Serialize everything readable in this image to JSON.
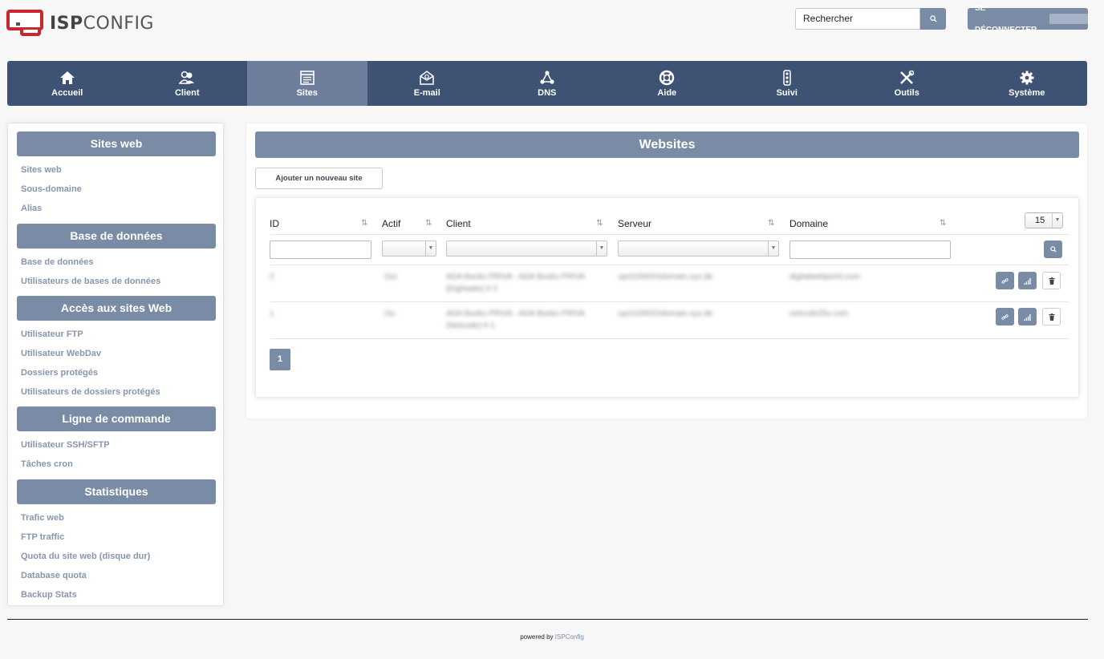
{
  "app": {
    "logo_bold": "ISP",
    "logo_light": "CONFIG"
  },
  "header": {
    "search_placeholder": "Rechercher",
    "logout_label": "SE DÉCONNECTER"
  },
  "nav": [
    {
      "label": "Accueil",
      "icon": "home-icon",
      "active": false
    },
    {
      "label": "Client",
      "icon": "users-icon",
      "active": false
    },
    {
      "label": "Sites",
      "icon": "sites-icon",
      "active": true
    },
    {
      "label": "E-mail",
      "icon": "email-icon",
      "active": false
    },
    {
      "label": "DNS",
      "icon": "dns-icon",
      "active": false
    },
    {
      "label": "Aide",
      "icon": "lifebuoy-icon",
      "active": false
    },
    {
      "label": "Suivi",
      "icon": "traffic-light-icon",
      "active": false
    },
    {
      "label": "Outils",
      "icon": "tools-icon",
      "active": false
    },
    {
      "label": "Système",
      "icon": "gear-icon",
      "active": false
    }
  ],
  "sidebar": {
    "sections": [
      {
        "title": "Sites web",
        "links": [
          "Sites web",
          "Sous-domaine",
          "Alias"
        ]
      },
      {
        "title": "Base de données",
        "links": [
          "Base de données",
          "Utilisateurs de bases de données"
        ]
      },
      {
        "title": "Accès aux sites Web",
        "links": [
          "Utilisateur FTP",
          "Utilisateur WebDav",
          "Dossiers protégés",
          "Utilisateurs de dossiers protégés"
        ]
      },
      {
        "title": "Ligne de commande",
        "links": [
          "Utilisateur SSH/SFTP",
          "Tâches cron"
        ]
      },
      {
        "title": "Statistiques",
        "links": [
          "Trafic web",
          "FTP traffic",
          "Quota du site web (disque dur)",
          "Database quota",
          "Backup Stats"
        ]
      }
    ]
  },
  "main": {
    "title": "Websites",
    "add_button": "Ajouter un nouveau site",
    "columns": [
      "ID",
      "Actif",
      "Client",
      "Serveur",
      "Domaine"
    ],
    "per_page": "15",
    "rows": [
      {
        "id": "2",
        "actif": "Oui",
        "client": "ADA Books PRIVA - ADA Books PRIVA (Eighwats) # 2",
        "serveur": "cpct1000XXdomain.xyz.de",
        "domaine": "digitalwebpoint.com"
      },
      {
        "id": "1",
        "actif": "Ou",
        "client": "ADA Books PRIVA - ADA Books PRIVA (Netcode) # 1",
        "serveur": "cpct1000XXdomain.xyz.de",
        "domaine": "netcode25x.com"
      }
    ],
    "page": "1"
  },
  "footer": {
    "text": "powered by",
    "link": "ISPConfig"
  },
  "colors": {
    "nav_bg": "#3e5374",
    "nav_active": "#6d7f9c",
    "accent": "#7a8ba5",
    "logo_red": "#c9272d"
  }
}
